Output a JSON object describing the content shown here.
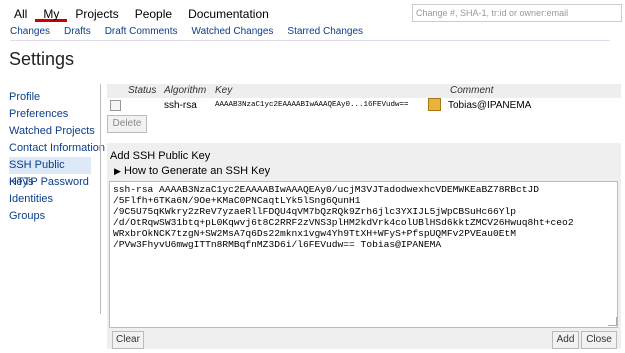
{
  "nav": {
    "tabs": [
      {
        "label": "All"
      },
      {
        "label": "My"
      },
      {
        "label": "Projects"
      },
      {
        "label": "People"
      },
      {
        "label": "Documentation"
      }
    ],
    "subtabs": [
      {
        "label": "Changes"
      },
      {
        "label": "Drafts"
      },
      {
        "label": "Draft Comments"
      },
      {
        "label": "Watched Changes"
      },
      {
        "label": "Starred Changes"
      }
    ],
    "search_placeholder": "Change #, SHA-1, tr:id or owner:email"
  },
  "page_title": "Settings",
  "sidebar": {
    "items": [
      {
        "label": "Profile"
      },
      {
        "label": "Preferences"
      },
      {
        "label": "Watched Projects"
      },
      {
        "label": "Contact Information"
      },
      {
        "label": "SSH Public Keys"
      },
      {
        "label": "HTTP Password"
      },
      {
        "label": "Identities"
      },
      {
        "label": "Groups"
      }
    ]
  },
  "keys_table": {
    "headers": {
      "status": "Status",
      "algorithm": "Algorithm",
      "key": "Key",
      "comment": "Comment"
    },
    "rows": [
      {
        "algorithm": "ssh-rsa",
        "key": "AAAAB3NzaC1yc2EAAAABIwAAAQEAy0...16FEVudw==",
        "comment": "Tobias@IPANEMA"
      }
    ],
    "delete_label": "Delete"
  },
  "add_key": {
    "title": "Add SSH Public Key",
    "howto_label": "How to Generate an SSH Key",
    "key_lines": [
      "ssh-rsa AAAAB3NzaC1yc2EAAAABIwAAAQEAy0/ucjM3VJTadodwexhcVDEMWKEaBZ78RBctJD",
      "/5Flfh+6TKa6N/9Oe+KMaC0PNCaqtLYk5lSng6QunH1",
      "/9C5U75qKWkry2zReV7yzaeRllFDQU4qVM7bQzRQk9Zrh6jlc3YXIJL5jWpCBSuHc66Ylp",
      "/d/OtRqwSW31btq+pL0Kqwvj6t8C2RRF2zVNS3plHM2kdVrk4colUBlHSd6kktZMCV26Hwuq8ht+ceo2",
      "WRxbrOkNCK7tzgN+SW2MsA7q6Ds22mknx1vgw4Yh9TtXH+WFyS+PfspUQMFv2PVEau0EtM",
      "/PVw3FhyvU6mwgITTn8RMBqfnMZ3D6i/l6FEVudw== Tobias@IPANEMA"
    ],
    "clear_label": "Clear",
    "add_label": "Add",
    "close_label": "Close"
  }
}
